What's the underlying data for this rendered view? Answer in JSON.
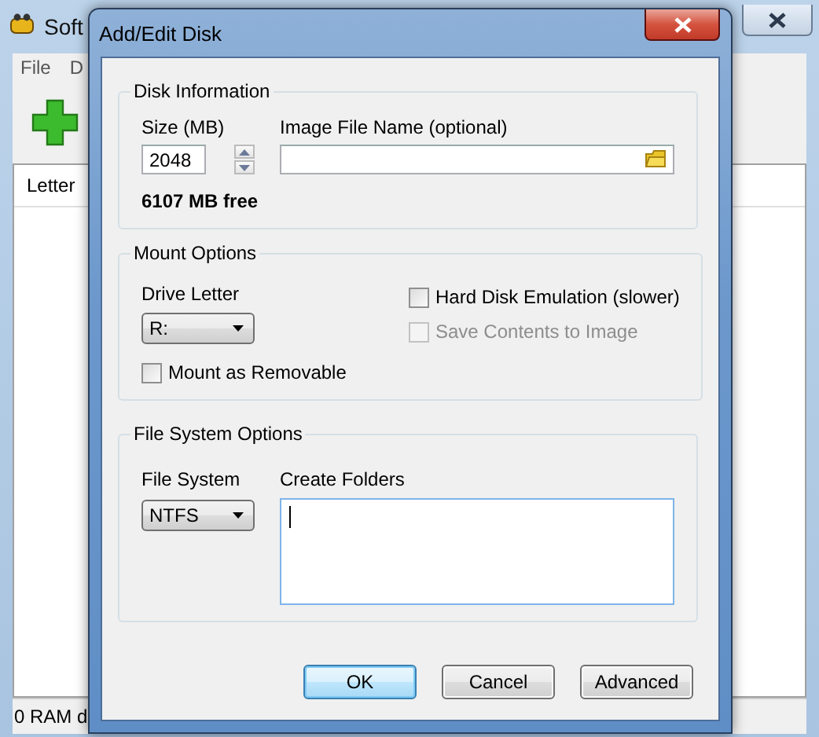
{
  "main_window": {
    "title": "Soft",
    "menu": [
      "File",
      "D"
    ],
    "list": {
      "columns": [
        "Letter"
      ]
    },
    "status_bar": "0 RAM d"
  },
  "dialog": {
    "title": "Add/Edit Disk",
    "disk_information": {
      "title": "Disk Information",
      "size": {
        "label": "Size (MB)",
        "value": "2048"
      },
      "image_file": {
        "label": "Image File Name (optional)"
      },
      "free_space": "6107 MB free"
    },
    "mount_options": {
      "title": "Mount Options",
      "drive_letter": {
        "label": "Drive Letter",
        "value": "R:"
      },
      "checkboxes": [
        {
          "label": "Hard Disk Emulation (slower)",
          "checked": false,
          "disabled": false
        },
        {
          "label": "Save Contents to Image",
          "checked": false,
          "disabled": true
        },
        {
          "label": "Mount as Removable",
          "checked": false,
          "disabled": false
        }
      ]
    },
    "file_system_options": {
      "title": "File System Options",
      "file_system": {
        "label": "File System",
        "value": "NTFS"
      },
      "create_folders": {
        "label": "Create Folders",
        "focused": true
      }
    },
    "buttons": [
      {
        "label": "OK",
        "default": true
      },
      {
        "label": "Cancel",
        "default": false
      },
      {
        "label": "Advanced",
        "default": false
      }
    ]
  }
}
